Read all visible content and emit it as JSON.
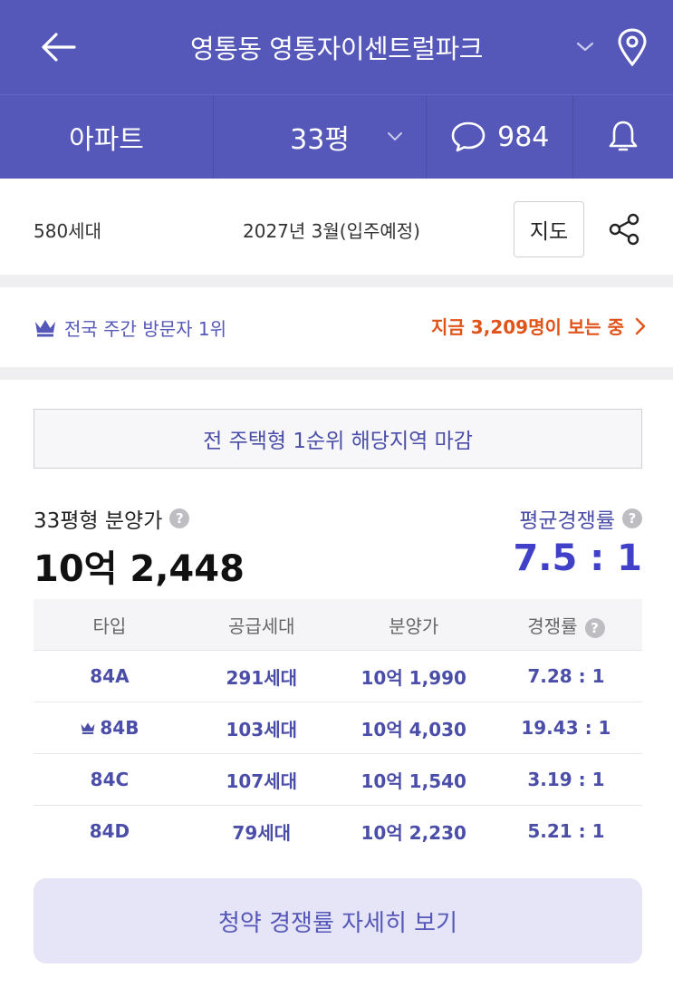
{
  "header": {
    "title": "영통동 영통자이센트럴파크",
    "tabs": {
      "type_label": "아파트",
      "size_label": "33평",
      "comment_count": "984"
    }
  },
  "info": {
    "households": "580세대",
    "move_in": "2027년 3월(입주예정)",
    "map_label": "지도"
  },
  "ranking": {
    "rank_text": "전국 주간 방문자 1위",
    "viewers_text": "지금 3,209명이 보는 중"
  },
  "notice": "전 주택형 1순위 해당지역 마감",
  "price": {
    "label": "33평형 분양가",
    "value": "10억 2,448"
  },
  "competition": {
    "label": "평균경쟁률",
    "value": "7.5 : 1"
  },
  "table": {
    "headers": [
      "타입",
      "공급세대",
      "분양가",
      "경쟁률"
    ],
    "rows": [
      {
        "type": "84A",
        "supply": "291세대",
        "price": "10억 1,990",
        "rate": "7.28 : 1",
        "crown": false
      },
      {
        "type": "84B",
        "supply": "103세대",
        "price": "10억 4,030",
        "rate": "19.43 : 1",
        "crown": true
      },
      {
        "type": "84C",
        "supply": "107세대",
        "price": "10억 1,540",
        "rate": "3.19 : 1",
        "crown": false
      },
      {
        "type": "84D",
        "supply": "79세대",
        "price": "10억 2,230",
        "rate": "5.21 : 1",
        "crown": false
      }
    ]
  },
  "detail_button": "청약 경쟁률 자세히 보기",
  "icons": {
    "back": "arrow-left-icon",
    "location": "map-pin-icon",
    "chevron": "chevron-down-icon",
    "comment": "speech-bubble-icon",
    "bell": "bell-icon",
    "share": "share-icon",
    "crown": "crown-icon",
    "arrow": "chevron-right-icon",
    "help": "question-icon"
  },
  "colors": {
    "brand": "#5558b8",
    "accent_text": "#4b4ea8",
    "highlight": "#e0541a",
    "rate_value": "#4040c8"
  }
}
